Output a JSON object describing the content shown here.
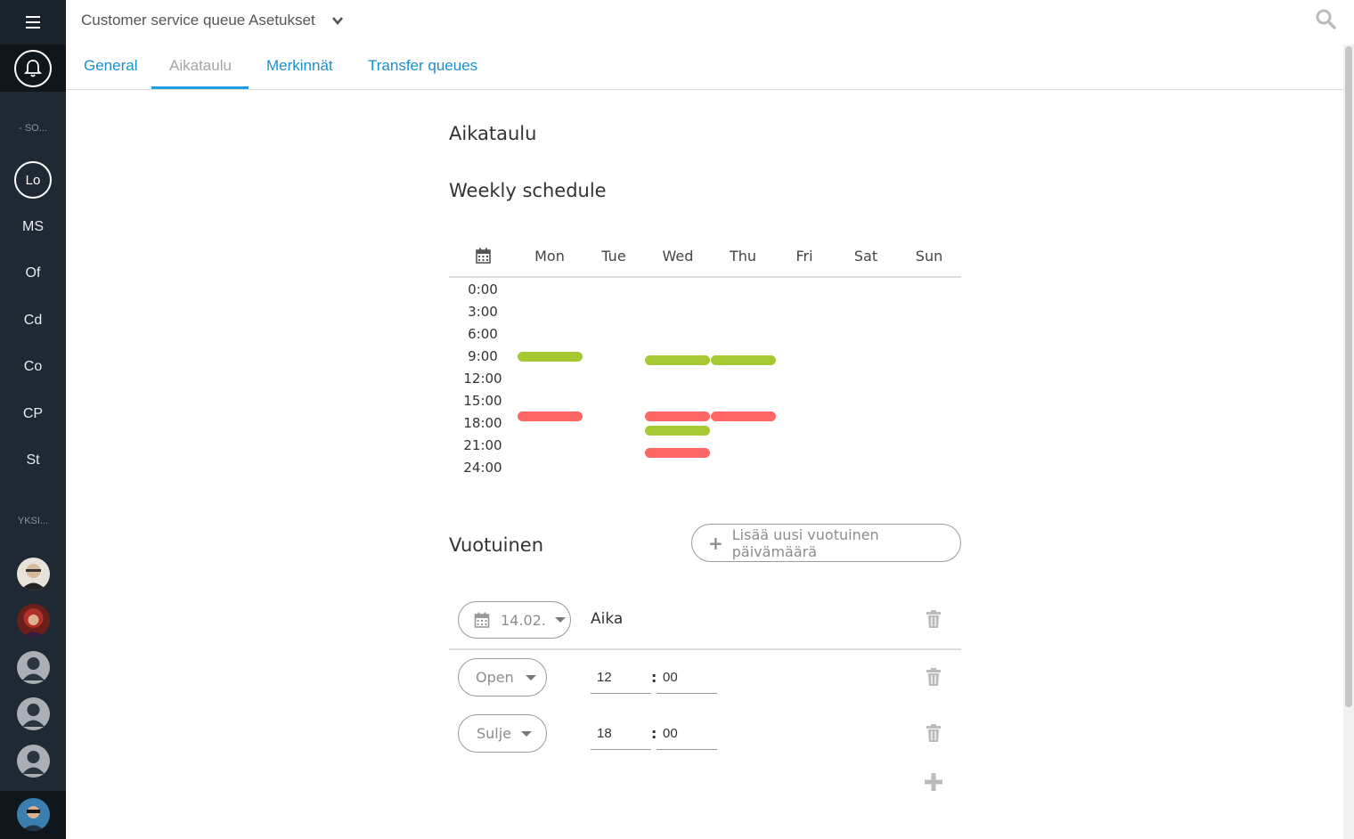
{
  "header": {
    "title": "Customer service queue Asetukset",
    "icons": [
      "menu-icon",
      "bell-icon",
      "chevron-down-icon",
      "search-icon"
    ]
  },
  "sidebar": {
    "section_1": "- SO...",
    "items": [
      "Lo",
      "MS",
      "Of",
      "Cd",
      "Co",
      "CP",
      "St"
    ],
    "section_2": "YKSI..."
  },
  "tabs": [
    {
      "label": "General",
      "active": false
    },
    {
      "label": "Aikataulu",
      "active": true
    },
    {
      "label": "Merkinnät",
      "active": false
    },
    {
      "label": "Transfer queues",
      "active": false
    }
  ],
  "main": {
    "heading": "Aikataulu",
    "weekly_heading": "Weekly schedule",
    "days": [
      "Mon",
      "Tue",
      "Wed",
      "Thu",
      "Fri",
      "Sat",
      "Sun"
    ],
    "hours": [
      "0:00",
      "3:00",
      "6:00",
      "9:00",
      "12:00",
      "15:00",
      "18:00",
      "21:00",
      "24:00"
    ],
    "colors": {
      "open": "#a6c832",
      "close": "#ff6666",
      "accent": "#1ea0e0",
      "link": "#1b8fcf"
    },
    "schedule": [
      {
        "day": "Mon",
        "type": "open",
        "hour": 9
      },
      {
        "day": "Mon",
        "type": "close",
        "hour": 17
      },
      {
        "day": "Wed",
        "type": "open",
        "hour": 9.5
      },
      {
        "day": "Wed",
        "type": "close",
        "hour": 17
      },
      {
        "day": "Wed",
        "type": "open",
        "hour": 19
      },
      {
        "day": "Wed",
        "type": "close",
        "hour": 22
      },
      {
        "day": "Thu",
        "type": "open",
        "hour": 9.5
      },
      {
        "day": "Thu",
        "type": "close",
        "hour": 17
      }
    ],
    "annual_heading": "Vuotuinen",
    "add_annual_label": "Lisää uusi vuotuinen päivämäärä",
    "annual_date": "14.02.",
    "time_label": "Aika",
    "rows": [
      {
        "type_label": "Open",
        "hour": "12",
        "minute": "00"
      },
      {
        "type_label": "Sulje",
        "hour": "18",
        "minute": "00"
      }
    ]
  }
}
